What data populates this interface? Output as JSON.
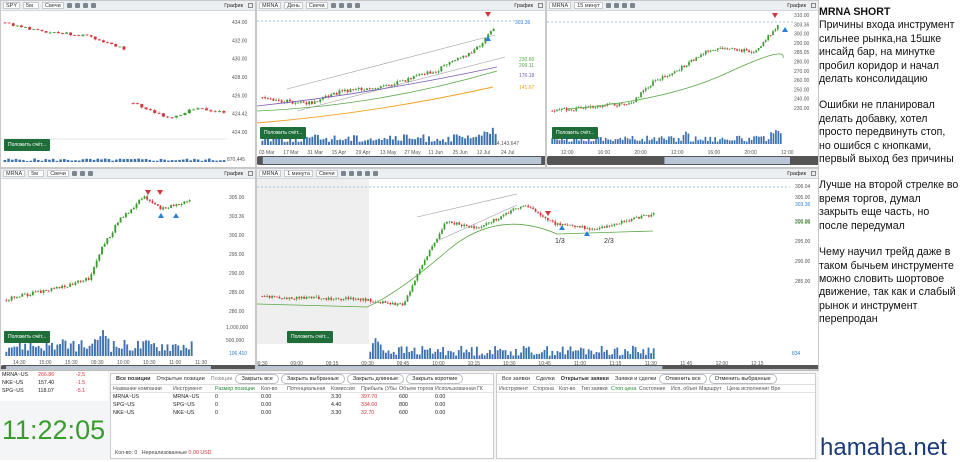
{
  "charts": {
    "spy": {
      "symbol": "SPY",
      "interval": "5м",
      "type": "Свечи",
      "title": "График",
      "prices": [
        "434.00",
        "432.00",
        "430.00",
        "428.00",
        "426.00",
        "424.42",
        "424.00"
      ],
      "volume": "870,445",
      "times": [
        "13:00",
        "14:00",
        "15:00",
        "10:00",
        "11:00",
        "12:00"
      ]
    },
    "daily": {
      "symbol": "MRNA",
      "interval": "День",
      "type": "Свечи",
      "title": "График",
      "prices": [
        "303.36",
        "230.60",
        "209.11",
        "176.18",
        "141.67"
      ],
      "volume": "14,143,647",
      "dates": [
        "03 Mar",
        "17 Mar",
        "31 Mar",
        "15 Apr",
        "29 Apr",
        "13 May",
        "27 May",
        "11 Jun",
        "25 Jun",
        "12 Jul",
        "24 Jul"
      ]
    },
    "m15": {
      "symbol": "MRNA",
      "interval": "15 минут",
      "title": "График",
      "prices": [
        "310.00",
        "303.36",
        "300.00",
        "290.00",
        "285.05",
        "280.00",
        "270.00",
        "260.00",
        "250.00",
        "240.00",
        "230.00"
      ],
      "times": [
        "12:00",
        "16:00",
        "20:00",
        "12:00",
        "16:00",
        "20:00",
        "12:00"
      ]
    },
    "m5": {
      "symbol": "MRNA",
      "interval": "5м",
      "type": "Свечи",
      "title": "График",
      "prices": [
        "305.00",
        "303.36",
        "300.00",
        "295.00",
        "290.00",
        "285.00",
        "280.00"
      ],
      "volumes": [
        "1,000,000",
        "500,000",
        "106,410"
      ],
      "times": [
        "14:30",
        "15:00",
        "15:30",
        "09:30",
        "10:00",
        "10:30",
        "11:00",
        "11:30"
      ]
    },
    "m1": {
      "symbol": "MRNA",
      "interval": "1 минута",
      "type": "Свечи",
      "title": "График",
      "prices": [
        "306.04",
        "305.00",
        "303.36",
        "300.00",
        "299.88",
        "295.00",
        "290.00",
        "285.00"
      ],
      "marks": [
        "1/3",
        "2/3"
      ],
      "volume": "834",
      "times": [
        "09:30",
        "09:00",
        "09:15",
        "09:30",
        "09:45",
        "10:00",
        "10:15",
        "10:30",
        "10:45",
        "11:00",
        "11:15",
        "11:30",
        "11:45",
        "12:00",
        "12:15"
      ]
    }
  },
  "order_button": "Положить счёт...",
  "watchlist": [
    {
      "symbol": "MRNA~US",
      "price": "266.86",
      "change": "-2.5"
    },
    {
      "symbol": "NKE~US",
      "price": "157.40",
      "change": "-1.5"
    },
    {
      "symbol": "SPG~US",
      "price": "118.07",
      "change": "-5.1"
    }
  ],
  "clock": "11:22:05",
  "positions": {
    "tabs": [
      "Все позиции",
      "Открытые позиции",
      "Позиции"
    ],
    "buttons": [
      "Закрыть все",
      "Закрыть выбранные",
      "Закрыть длинные",
      "Закрыть короткие"
    ],
    "columns": [
      "Название компании",
      "Инструмент",
      "Размер позиции",
      "Кол-во",
      "Потенциальная",
      "Комиссия",
      "Прибыль (Убы",
      "Объем торгов",
      "Использованная ПС"
    ],
    "rows": [
      [
        "MRNA~US",
        "MRNA~US",
        "0",
        "0.00",
        "3.30",
        "397.70",
        "600",
        "0.00"
      ],
      [
        "SPG~US",
        "SPG~US",
        "0",
        "0.00",
        "4.40",
        "334.60",
        "800",
        "0.00"
      ],
      [
        "NKE~US",
        "NKE~US",
        "0",
        "0.00",
        "3.30",
        "32.70",
        "600",
        "0.00"
      ]
    ],
    "footer_count": "Кол-во: 0",
    "footer_unrealized": "Нереализованные",
    "footer_amount": "0.00 USD"
  },
  "orders": {
    "tabs": [
      "Все заявки",
      "Сделки",
      "Открытые заявки",
      "Заявки и сделки"
    ],
    "buttons": [
      "Отменить все",
      "Отменить выбранные"
    ],
    "columns": [
      "Инструмент",
      "Сторона",
      "Кол-во",
      "Тип заявки",
      "Стоп цена",
      "Состояние",
      "Исп. объем",
      "Маршрут",
      "Цена исполнения",
      "Вре"
    ]
  },
  "notes": {
    "title": "MRNA SHORT",
    "p1": "Причины входа инструмент сильнее рынка,на 15шке инсайд бар, на минутке пробил коридор и начал делать консолидацию",
    "p2": "Ошибки не планировал делать добавку, хотел просто передвинуть стоп, но ошибся с кнопками, первый выход без причины",
    "p3": "Лучше  на второй стрелке во время торгов, думал закрыть еще часть, но после передумал",
    "p4": "Чему научил трейд даже в таком бычьем инструменте можно словить шортовое движение, так как и слабый рынок и инструмент перепродан"
  },
  "watermark": "hamaha.net",
  "colors": {
    "green": "#3a9b2e",
    "red": "#d6343a",
    "blue": "#2a7fd4",
    "orderBtn": "#1f6e3a"
  }
}
